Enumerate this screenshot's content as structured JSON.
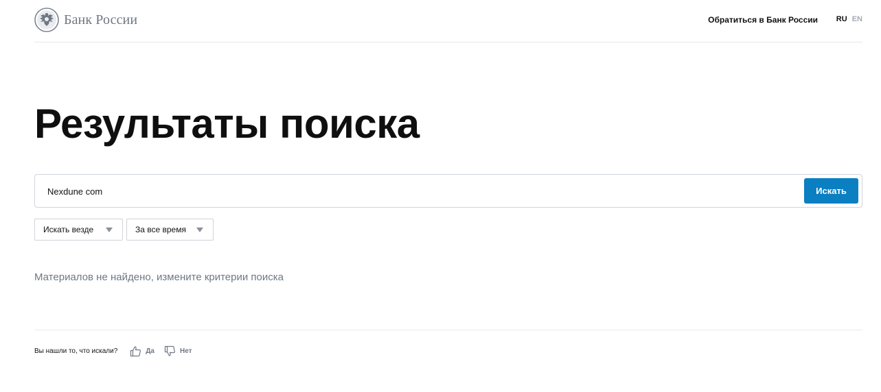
{
  "header": {
    "logo_text": "Банк России",
    "contact_link": "Обратиться в Банк России",
    "lang_ru": "RU",
    "lang_en": "EN"
  },
  "page": {
    "title": "Результаты поиска"
  },
  "search": {
    "value": "Nexdune com",
    "button_label": "Искать"
  },
  "filters": {
    "scope": "Искать везде",
    "period": "За все время"
  },
  "results": {
    "empty_message": "Материалов не найдено, измените критерии поиска"
  },
  "feedback": {
    "question": "Вы нашли то, что искали?",
    "yes_label": "Да",
    "no_label": "Нет"
  },
  "colors": {
    "accent": "#0a7fc2",
    "muted_text": "#6f7784",
    "border": "#cfd3d9"
  }
}
